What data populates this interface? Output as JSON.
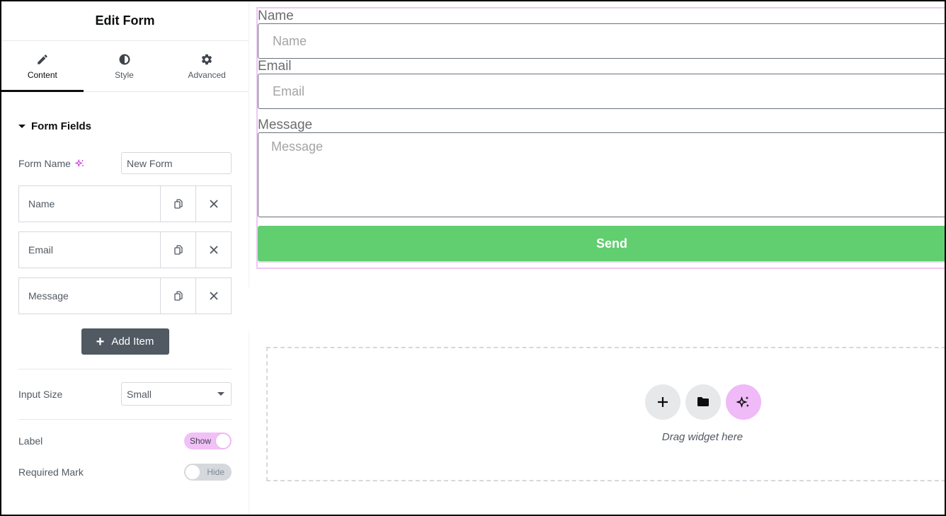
{
  "sidebar": {
    "title": "Edit Form",
    "tabs": [
      {
        "label": "Content",
        "icon": "pencil-icon",
        "active": true
      },
      {
        "label": "Style",
        "icon": "half-circle-icon",
        "active": false
      },
      {
        "label": "Advanced",
        "icon": "gear-icon",
        "active": false
      }
    ],
    "section_title": "Form Fields",
    "form_name": {
      "label": "Form Name",
      "value": "New Form"
    },
    "fields": [
      {
        "label": "Name"
      },
      {
        "label": "Email"
      },
      {
        "label": "Message"
      }
    ],
    "add_item_label": "Add Item",
    "input_size": {
      "label": "Input Size",
      "value": "Small"
    },
    "label_toggle": {
      "label": "Label",
      "state": "Show"
    },
    "required_toggle": {
      "label": "Required Mark",
      "state": "Hide"
    }
  },
  "canvas": {
    "form": {
      "name_label": "Name",
      "name_placeholder": "Name",
      "email_label": "Email",
      "email_placeholder": "Email",
      "message_label": "Message",
      "message_placeholder": "Message",
      "submit_label": "Send"
    },
    "dropzone": {
      "text": "Drag widget here"
    }
  },
  "colors": {
    "accent_pink": "#f0b9f7",
    "submit_green": "#61ce70",
    "button_dark": "#515962"
  }
}
